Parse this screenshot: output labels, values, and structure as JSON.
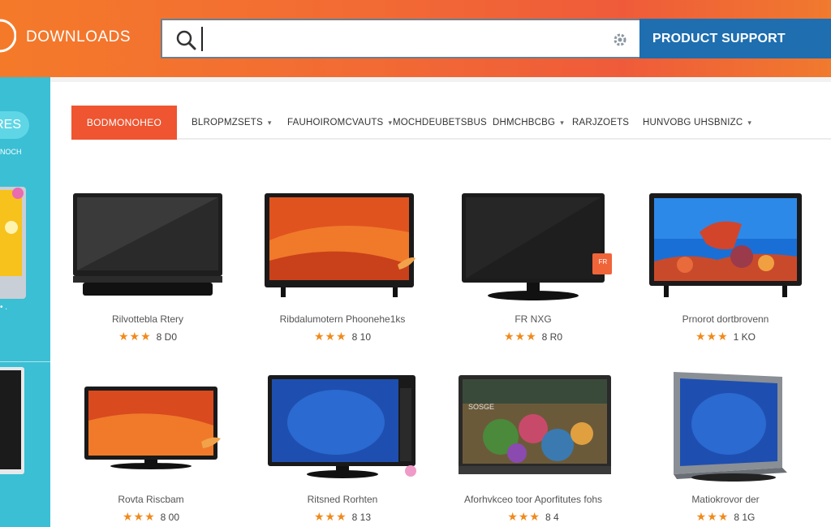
{
  "header": {
    "logo_text": "DOWNLOADS",
    "search": {
      "value": "",
      "placeholder": ""
    },
    "support_label": "PRODUCT SUPPORT"
  },
  "sidebar": {
    "pill_label": "RES",
    "label": "NOCH",
    "dots": "• ."
  },
  "categories": {
    "active": "BODMONOHEO",
    "tabs": [
      "BLROPMZSETS",
      "FAUHOIROMCVAUTS",
      "MOCHDEUBETSBUS",
      "DHMCHBCBG",
      "RARJZOETS",
      "HUNVOBG UHSBNIZC"
    ]
  },
  "products": [
    {
      "name": "Rilvottebla Rtery",
      "stars": "★★★",
      "price": "8 D0",
      "screen": "dark"
    },
    {
      "name": "Ribdalumotern Phoonehe1ks",
      "stars": "★★★",
      "price": "8 10",
      "screen": "orange"
    },
    {
      "name": "FR NXG",
      "stars": "★★★",
      "price": "8 R0",
      "screen": "dark",
      "badge": "FR"
    },
    {
      "name": "Prnorot dortbrovenn",
      "stars": "★★★",
      "price": "1 KO",
      "screen": "art"
    },
    {
      "name": "Rovta Riscbam",
      "stars": "★★★",
      "price": "8 00",
      "screen": "orange"
    },
    {
      "name": "Ritsned Rorhten",
      "stars": "★★★",
      "price": "8 13",
      "screen": "blue"
    },
    {
      "name": "Aforhvkceo toor Aporfitutes fohs",
      "stars": "★★★",
      "price": "8 4",
      "screen": "nature",
      "screen_text": "SOSGE"
    },
    {
      "name": "Matiokrovor der",
      "stars": "★★★",
      "price": "8 1G",
      "screen": "blue"
    }
  ],
  "colors": {
    "header_orange": "#f47a2a",
    "support_blue": "#1e6eb0",
    "sidebar_teal": "#3bbfd4",
    "active_tab": "#ee5530",
    "star": "#f08a1c"
  }
}
